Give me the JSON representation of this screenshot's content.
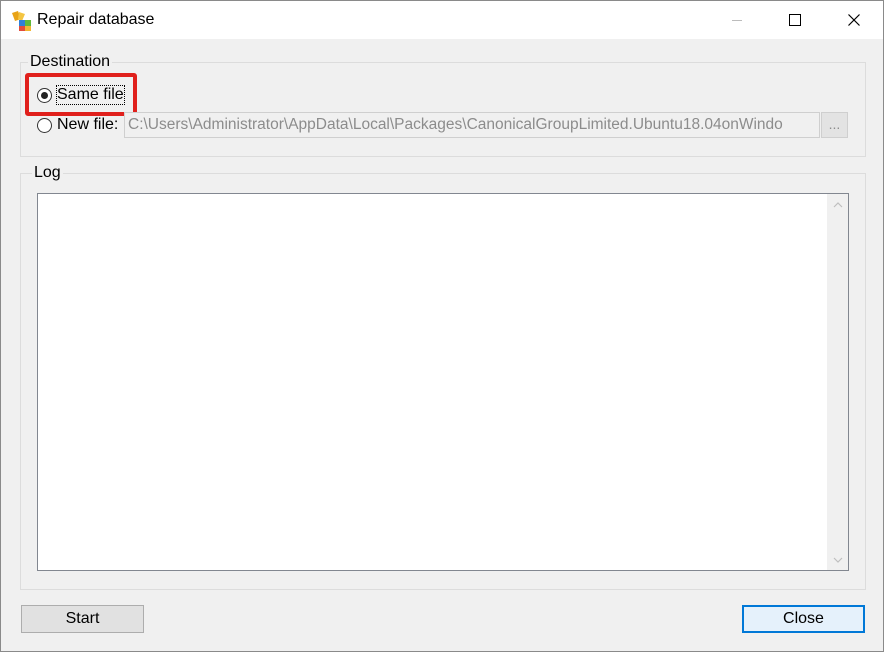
{
  "window": {
    "title": "Repair database",
    "icon": "repair-database-app-icon",
    "caption_buttons": [
      "minimize-icon",
      "maximize-icon",
      "close-icon"
    ]
  },
  "destination": {
    "legend": "Destination",
    "options": [
      {
        "label": "Same file",
        "selected": true
      },
      {
        "label": "New file:",
        "selected": false
      }
    ],
    "new_file_path": "C:\\Users\\Administrator\\AppData\\Local\\Packages\\CanonicalGroupLimited.Ubuntu18.04onWindo",
    "browse_label": "..."
  },
  "log": {
    "legend": "Log",
    "content": ""
  },
  "buttons": {
    "start_label": "Start",
    "close_label": "Close"
  },
  "colors": {
    "highlight": "#e0201c",
    "default_button_border": "#0078d7",
    "disabled_text": "#8c8c8c"
  }
}
